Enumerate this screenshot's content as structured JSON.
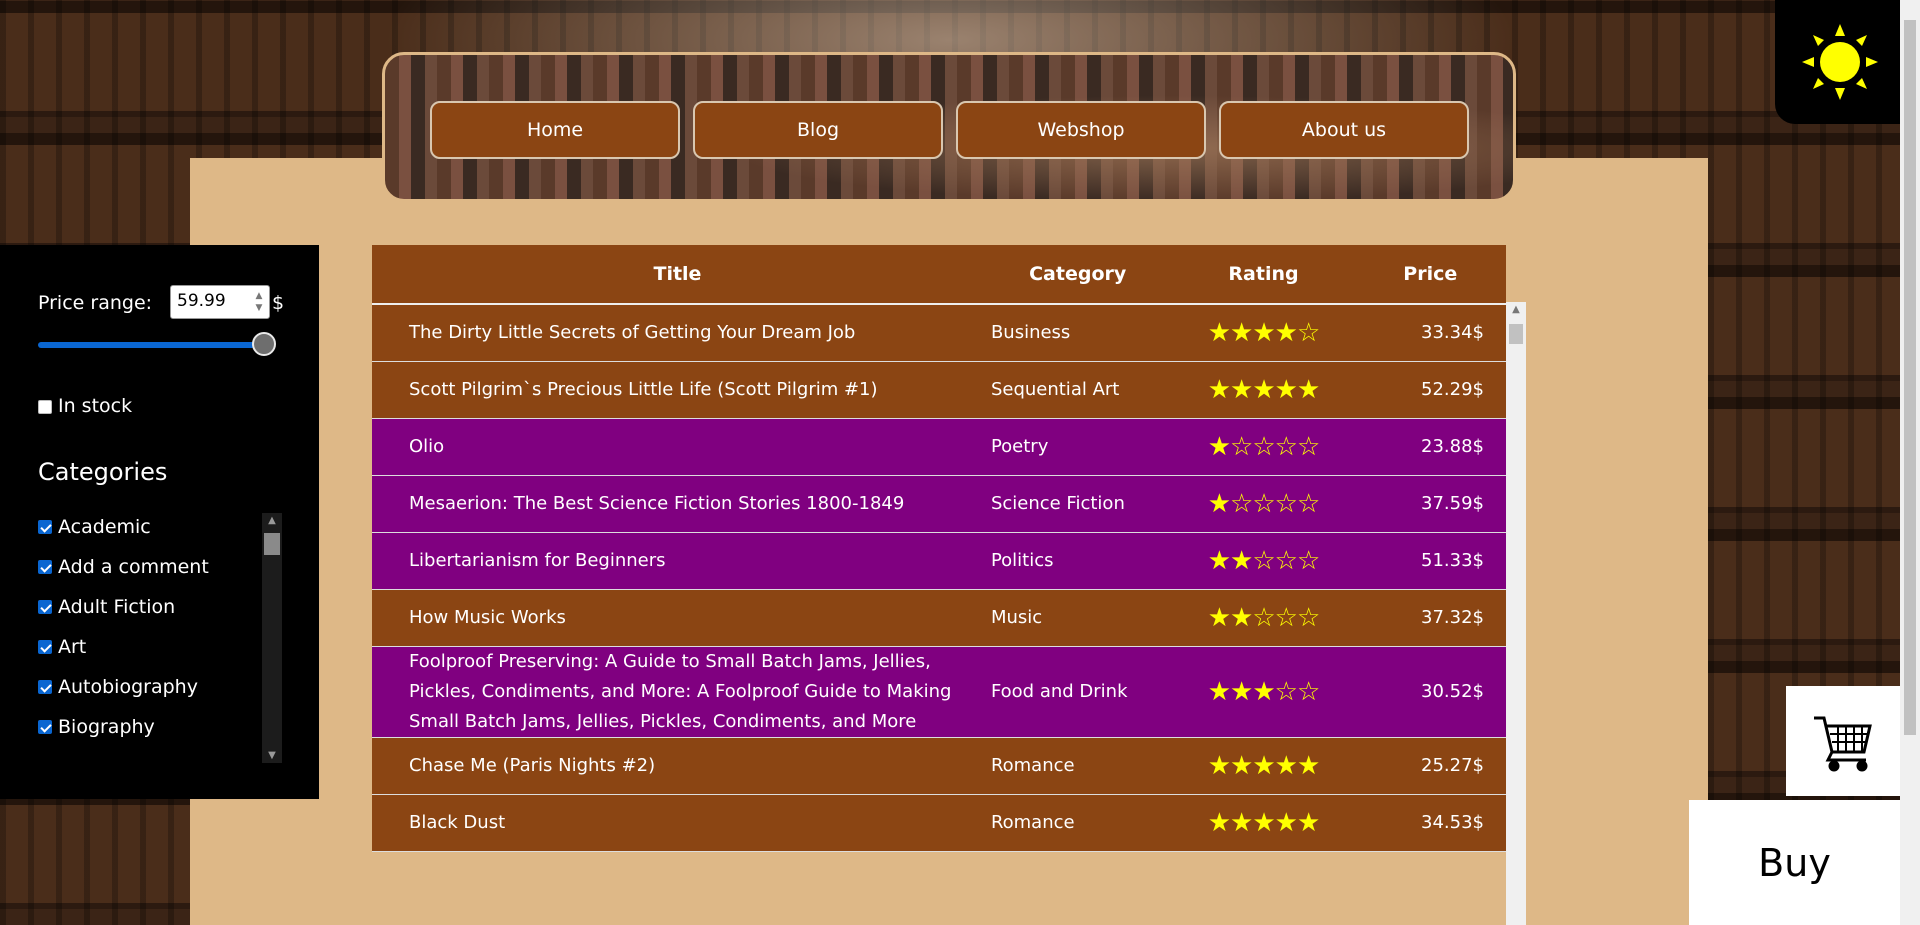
{
  "nav": {
    "items": [
      "Home",
      "Blog",
      "Webshop",
      "About us"
    ]
  },
  "filters": {
    "price_label": "Price range:",
    "price_value": "59.99",
    "currency": "$",
    "price_slider_fraction": 1.0,
    "in_stock_label": "In stock",
    "in_stock_checked": false,
    "categories_title": "Categories",
    "categories": [
      {
        "label": "Academic",
        "checked": true
      },
      {
        "label": "Add a comment",
        "checked": true
      },
      {
        "label": "Adult Fiction",
        "checked": true
      },
      {
        "label": "Art",
        "checked": true
      },
      {
        "label": "Autobiography",
        "checked": true
      },
      {
        "label": "Biography",
        "checked": true
      }
    ]
  },
  "table": {
    "headers": {
      "title": "Title",
      "category": "Category",
      "rating": "Rating",
      "price": "Price"
    },
    "rows": [
      {
        "title": "The Dirty Little Secrets of Getting Your Dream Job",
        "category": "Business",
        "rating": 4,
        "price": "33.34$",
        "color": "brown"
      },
      {
        "title": "Scott Pilgrim`s Precious Little Life (Scott Pilgrim #1)",
        "category": "Sequential Art",
        "rating": 5,
        "price": "52.29$",
        "color": "brown"
      },
      {
        "title": "Olio",
        "category": "Poetry",
        "rating": 1,
        "price": "23.88$",
        "color": "purple"
      },
      {
        "title": "Mesaerion: The Best Science Fiction Stories 1800-1849",
        "category": "Science Fiction",
        "rating": 1,
        "price": "37.59$",
        "color": "purple"
      },
      {
        "title": "Libertarianism for Beginners",
        "category": "Politics",
        "rating": 2,
        "price": "51.33$",
        "color": "purple"
      },
      {
        "title": "How Music Works",
        "category": "Music",
        "rating": 2,
        "price": "37.32$",
        "color": "brown"
      },
      {
        "title": "Foolproof Preserving: A Guide to Small Batch Jams, Jellies, Pickles, Condiments, and More: A Foolproof Guide to Making Small Batch Jams, Jellies, Pickles, Condiments, and More",
        "category": "Food and Drink",
        "rating": 3,
        "price": "30.52$",
        "color": "purple"
      },
      {
        "title": "Chase Me (Paris Nights #2)",
        "category": "Romance",
        "rating": 5,
        "price": "25.27$",
        "color": "brown"
      },
      {
        "title": "Black Dust",
        "category": "Romance",
        "rating": 5,
        "price": "34.53$",
        "color": "brown"
      }
    ]
  },
  "icons": {
    "theme": "sun-icon",
    "cart": "cart-icon"
  },
  "colors": {
    "brown": "#8b4513",
    "purple": "#800080",
    "tan": "#deb887",
    "star": "#ffff00"
  },
  "buy_label": "Buy"
}
